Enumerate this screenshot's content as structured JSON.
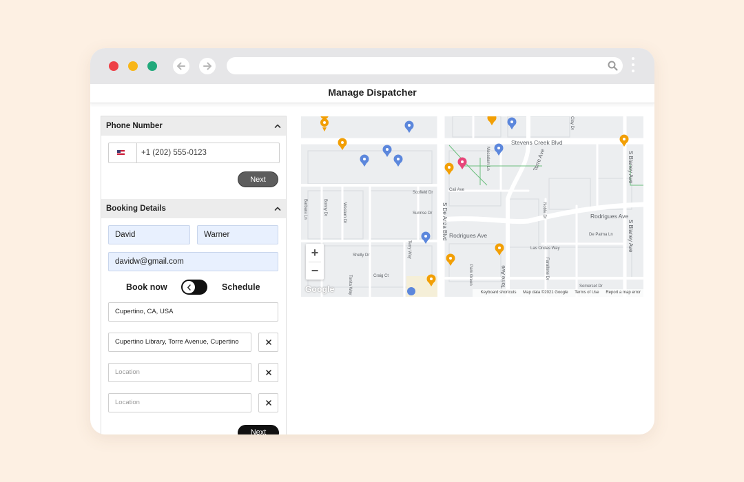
{
  "page": {
    "title": "Manage Dispatcher"
  },
  "phone_section": {
    "title": "Phone Number",
    "country_flag": "us-flag-icon",
    "phone_value": "+1 (202) 555-0123",
    "next_label": "Next"
  },
  "booking_section": {
    "title": "Booking Details",
    "first_name": "David",
    "last_name": "Warner",
    "email": "davidw@gmail.com",
    "toggle_left": "Book now",
    "toggle_right": "Schedule",
    "pickup": "Cupertino, CA, USA",
    "dropoff": "Cupertino Library, Torre Avenue, Cupertino",
    "stop1_placeholder": "Location",
    "stop2_placeholder": "Location",
    "next_label": "Next"
  },
  "map": {
    "streets": {
      "stevens_creek": "Stevens Creek Blvd",
      "torre_ave": "Torre Ave",
      "torre_ave2": "Torre Ave",
      "s_blaney": "S Blaney Ave",
      "s_blaney2": "S Blaney Ave",
      "rodrigues": "Rodrigues Ave",
      "rodrigues2": "Rodrigues Ave",
      "s_de_anza": "S De Anza Blvd",
      "macadam": "Macadam Ln",
      "scofield": "Scofield Dr",
      "sunrise": "Sunrise Dr",
      "shelly": "Shelly Dr",
      "craig": "Craig Ct",
      "terry": "Terry Way",
      "bonny": "Bonny Dr",
      "western": "Western Dr",
      "barbara": "Barbara Ln",
      "tonita": "Tonita Way",
      "cali": "Cali Ave",
      "de_palma": "De Palma Ln",
      "las_ondas": "Las Ondas Way",
      "park_green": "Park Green",
      "farallone": "Farallone Dr",
      "somerset": "Somerset Dr",
      "noble": "Noble Dr",
      "clay": "Clay Dr"
    },
    "footer": {
      "shortcuts": "Keyboard shortcuts",
      "map_data": "Map data ©2021 Google",
      "terms": "Terms of Use",
      "report": "Report a map error"
    },
    "logo": "Google",
    "zoom_in": "+",
    "zoom_out": "−",
    "colors": {
      "food_pin": "#f29f05",
      "shop_pin": "#5c87dc",
      "hotel_pin": "#e7467a"
    }
  },
  "colors": {
    "background": "#fdf0e3",
    "accent_black": "#111111",
    "field_fill": "#e8f0fe"
  }
}
